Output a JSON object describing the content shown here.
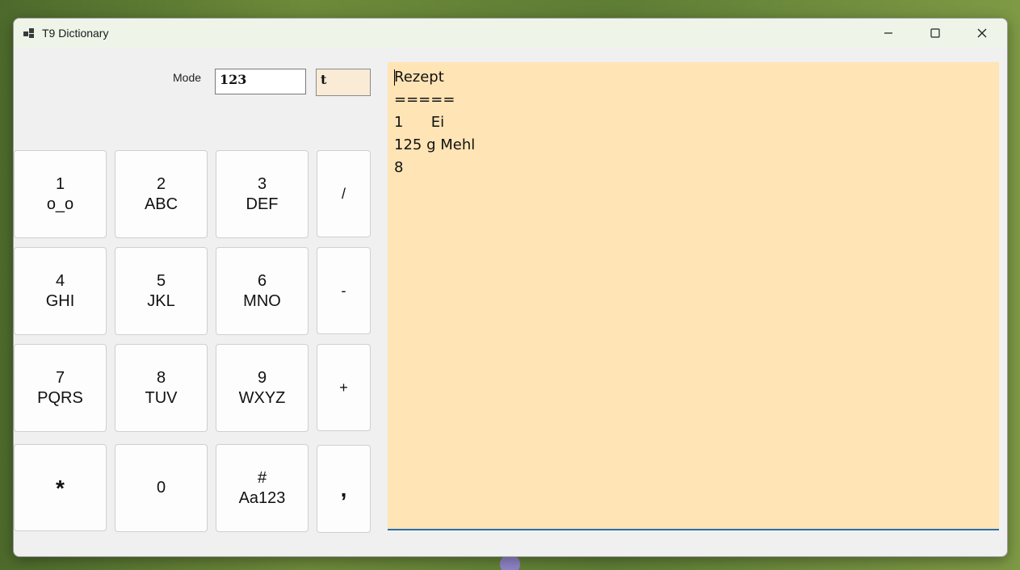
{
  "window": {
    "title": "T9 Dictionary",
    "controls": {
      "minimize": "minimize-icon",
      "maximize": "maximize-icon",
      "close": "close-icon"
    }
  },
  "mode": {
    "label": "Mode",
    "value": "123",
    "current_char": "t"
  },
  "keypad": {
    "keys": [
      {
        "digit": "1",
        "letters": "o_o"
      },
      {
        "digit": "2",
        "letters": "ABC"
      },
      {
        "digit": "3",
        "letters": "DEF"
      },
      {
        "digit": "/",
        "letters": ""
      },
      {
        "digit": "4",
        "letters": "GHI"
      },
      {
        "digit": "5",
        "letters": "JKL"
      },
      {
        "digit": "6",
        "letters": "MNO"
      },
      {
        "digit": "-",
        "letters": ""
      },
      {
        "digit": "7",
        "letters": "PQRS"
      },
      {
        "digit": "8",
        "letters": "TUV"
      },
      {
        "digit": "9",
        "letters": "WXYZ"
      },
      {
        "digit": "+",
        "letters": ""
      },
      {
        "digit": "*",
        "letters": ""
      },
      {
        "digit": "0",
        "letters": ""
      },
      {
        "digit": "#",
        "letters": "Aa123"
      },
      {
        "digit": ",",
        "letters": ""
      }
    ]
  },
  "editor": {
    "lines": [
      "Rezept",
      "=====",
      "1      Ei",
      "125 g Mehl",
      "8"
    ]
  },
  "colors": {
    "editor_bg": "#ffe4b5",
    "char_box_bg": "#faebd7",
    "underline_accent": "#2a6ea8"
  }
}
